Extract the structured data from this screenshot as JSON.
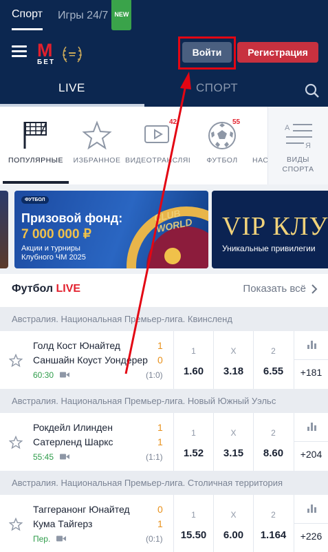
{
  "top_tabs": [
    {
      "label": "Спорт",
      "active": true
    },
    {
      "label": "Игры 24/7",
      "active": false,
      "badge": "NEW"
    }
  ],
  "header": {
    "logo_m": "M",
    "logo_bet": "БЕТ",
    "login_label": "Войти",
    "register_label": "Регистрация"
  },
  "nav": {
    "live": "LIVE",
    "sport": "СПОРТ"
  },
  "categories": [
    {
      "label": "ПОПУЛЯРНЫЕ",
      "icon": "flag-grid-icon",
      "active": true
    },
    {
      "label": "ИЗБРАННОЕ",
      "icon": "star-icon"
    },
    {
      "label": "ВИДЕОТРАНСЛЯЦИИ",
      "icon": "video-icon",
      "count": "42"
    },
    {
      "label": "ФУТБОЛ",
      "icon": "football-icon",
      "count": "55"
    },
    {
      "label": "НАСТОЛЬНЫЙ ТЕННИС",
      "icon": "table-tennis-icon"
    },
    {
      "label_line1": "ВИДЫ",
      "label_line2": "СПОРТА",
      "icon": "sports-list-icon"
    }
  ],
  "banners": {
    "main": {
      "tag": "ФУТБОЛ",
      "title": "Призовой фонд:",
      "amount": "7 000 000 ₽",
      "subtitle": "Акции и турниры Клубного ЧМ 2025",
      "decor": "CLUB WORLD"
    },
    "vip": {
      "title": "VIP КЛУБ",
      "subtitle": "Уникальные привилегии"
    }
  },
  "section": {
    "title": "Футбол",
    "live": "LIVE",
    "show_all": "Показать всё"
  },
  "matches": [
    {
      "league": "Австралия. Национальная Премьер-лига. Квинсленд",
      "team1": "Голд Кост Юнайтед",
      "team2": "Саншайн Коуст Уондерер",
      "score1": "1",
      "score2": "0",
      "time": "60:30",
      "result": "(1:0)",
      "odds": [
        {
          "label": "1",
          "value": "1.60"
        },
        {
          "label": "X",
          "value": "3.18"
        },
        {
          "label": "2",
          "value": "6.55"
        }
      ],
      "more": "+181"
    },
    {
      "league": "Австралия. Национальная Премьер-лига. Новый Южный Уэльс",
      "team1": "Рокдейл Илинден",
      "team2": "Сатерленд Шаркс",
      "score1": "1",
      "score2": "1",
      "time": "55:45",
      "result": "(1:1)",
      "odds": [
        {
          "label": "1",
          "value": "1.52"
        },
        {
          "label": "X",
          "value": "3.15"
        },
        {
          "label": "2",
          "value": "8.60"
        }
      ],
      "more": "+204"
    },
    {
      "league": "Австралия. Национальная Премьер-лига. Столичная территория",
      "team1": "Таггеранонг Юнайтед",
      "team2": "Кума Тайгерз",
      "score1": "0",
      "score2": "1",
      "time": "Пер.",
      "result": "(0:1)",
      "odds": [
        {
          "label": "1",
          "value": "15.50"
        },
        {
          "label": "X",
          "value": "6.00"
        },
        {
          "label": "2",
          "value": "1.164"
        }
      ],
      "more": "+226"
    }
  ],
  "colors": {
    "navy": "#0c2750",
    "accent_red": "#e2202d",
    "live_green": "#2e9c4a",
    "score_orange": "#e8901a",
    "annotation_red": "#e30613"
  }
}
